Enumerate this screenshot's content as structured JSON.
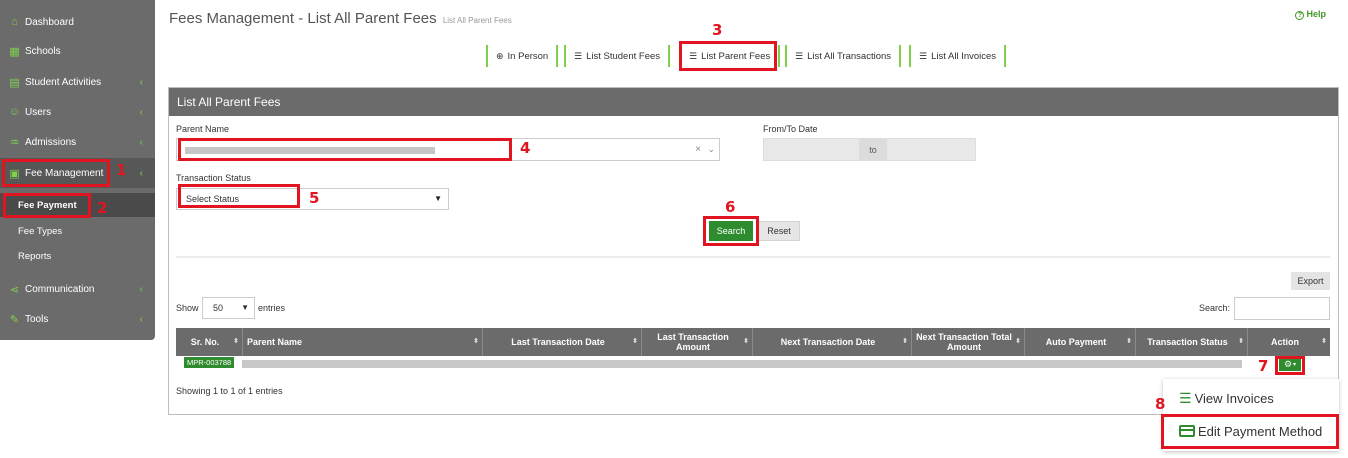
{
  "sidebar": {
    "items": [
      {
        "label": "Dashboard",
        "icon": "home-icon",
        "glyph": "⌂"
      },
      {
        "label": "Schools",
        "icon": "building-icon",
        "glyph": "▦"
      },
      {
        "label": "Student Activities",
        "icon": "calendar-icon",
        "glyph": "▤"
      },
      {
        "label": "Users",
        "icon": "users-icon",
        "glyph": "☺"
      },
      {
        "label": "Admissions",
        "icon": "graduation-cap-icon",
        "glyph": "♒"
      },
      {
        "label": "Fee Management",
        "icon": "fee-icon",
        "glyph": "▣"
      },
      {
        "label": "Communication",
        "icon": "share-icon",
        "glyph": "⋖"
      },
      {
        "label": "Tools",
        "icon": "wrench-icon",
        "glyph": "✎"
      }
    ],
    "subitems": [
      "Fee Payment",
      "Fee Types",
      "Reports"
    ],
    "chevron": "‹"
  },
  "header": {
    "title": "Fees Management - List All Parent Fees",
    "subtitle": "List All Parent Fees",
    "help": "Help",
    "help_icon": "?"
  },
  "tabs": [
    {
      "label": "In Person",
      "icon": "plus-circle-icon",
      "glyph": "⊕"
    },
    {
      "label": "List Student Fees",
      "icon": "list-icon",
      "glyph": "☰"
    },
    {
      "label": "List Parent Fees",
      "icon": "list-icon",
      "glyph": "☰"
    },
    {
      "label": "List All Transactions",
      "icon": "list-icon",
      "glyph": "☰"
    },
    {
      "label": "List All Invoices",
      "icon": "list-icon",
      "glyph": "☰"
    }
  ],
  "panel": {
    "title": "List All Parent Fees",
    "parent_label": "Parent Name",
    "date_label": "From/To Date",
    "date_to": "to",
    "status_label": "Transaction Status",
    "status_value": "Select Status",
    "search_btn": "Search",
    "reset_btn": "Reset",
    "export_btn": "Export",
    "show_label": "Show",
    "entries_value": "50",
    "entries_label": "entries",
    "search_label": "Search:",
    "showing": "Showing 1 to 1 of 1 entries"
  },
  "table": {
    "columns": [
      "Sr. No.",
      "Parent Name",
      "Last Transaction Date",
      "Last Transaction Amount",
      "Next Transaction Date",
      "Next Transaction Total Amount",
      "Auto Payment",
      "Transaction Status",
      "Action"
    ],
    "rows": [
      {
        "id": "MPR-003788"
      }
    ]
  },
  "dropdown": {
    "items": [
      "View Invoices",
      "Edit Payment Method"
    ]
  },
  "annotations": [
    "1",
    "2",
    "3",
    "4",
    "5",
    "6",
    "7",
    "8"
  ],
  "colors": {
    "accent": "#2e8b2e",
    "highlight": "#e0151f",
    "sidebar": "#6b6b6b"
  }
}
